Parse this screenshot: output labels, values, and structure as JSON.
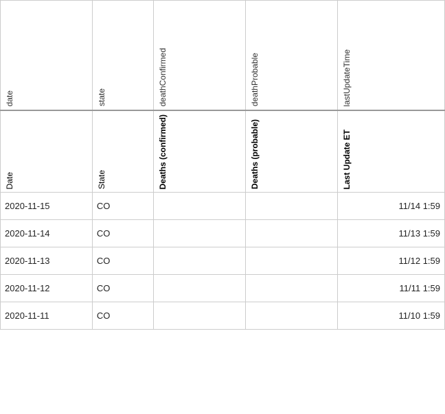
{
  "table": {
    "header1": {
      "col1": {
        "label": "date"
      },
      "col2": {
        "label": "state"
      },
      "col3": {
        "label": "deathConfirmed"
      },
      "col4": {
        "label": "deathProbable"
      },
      "col5": {
        "label": "lastUpdateTime"
      }
    },
    "header2": {
      "col1": {
        "label": "Date"
      },
      "col2": {
        "label": "State"
      },
      "col3": {
        "label": "Deaths (confirmed)"
      },
      "col4": {
        "label": "Deaths (probable)"
      },
      "col5": {
        "label": "Last Update ET"
      }
    },
    "rows": [
      {
        "date": "2020-11-15",
        "state": "CO",
        "confirmed": "",
        "probable": "",
        "lastUpdate": "11/14 1:59"
      },
      {
        "date": "2020-11-14",
        "state": "CO",
        "confirmed": "",
        "probable": "",
        "lastUpdate": "11/13 1:59"
      },
      {
        "date": "2020-11-13",
        "state": "CO",
        "confirmed": "",
        "probable": "",
        "lastUpdate": "11/12 1:59"
      },
      {
        "date": "2020-11-12",
        "state": "CO",
        "confirmed": "",
        "probable": "",
        "lastUpdate": "11/11 1:59"
      },
      {
        "date": "2020-11-11",
        "state": "CO",
        "confirmed": "",
        "probable": "",
        "lastUpdate": "11/10 1:59"
      }
    ]
  }
}
